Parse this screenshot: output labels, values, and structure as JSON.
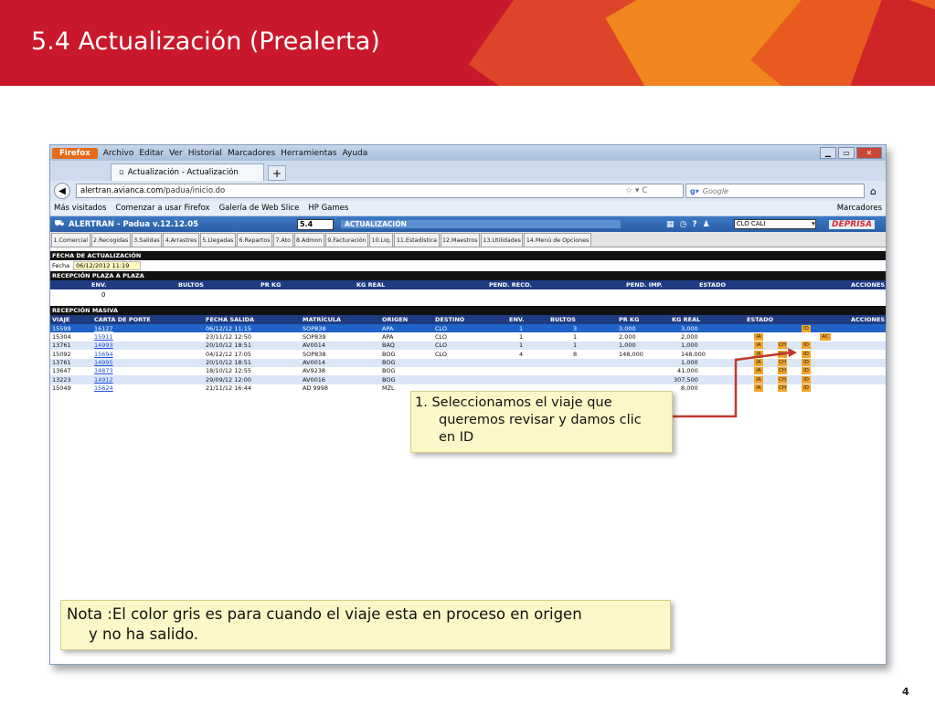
{
  "slide": {
    "title": "5.4 Actualización (Prealerta)",
    "page_number": "4"
  },
  "browser": {
    "firefox_button": "Firefox",
    "menu": [
      "Archivo",
      "Editar",
      "Ver",
      "Historial",
      "Marcadores",
      "Herramientas",
      "Ayuda"
    ],
    "tab_title": "Actualización - Actualización",
    "url_host": "alertran.avianca.com",
    "url_path": "/padua/inicio.do",
    "search_placeholder": "Google",
    "bookmarks": [
      "Más visitados",
      "Comenzar a usar Firefox",
      "Galería de Web Slice",
      "HP Games"
    ],
    "bookmarks_right": "Marcadores"
  },
  "app": {
    "name": "ALERTRAN - Padua  v.12.12.05",
    "module_code": "5.4",
    "module_name": "ACTUALIZACIÓN",
    "branch": "CLO CALI",
    "brand": "DEPRISA",
    "module_tabs": [
      "1.Comercial",
      "2.Recogidas",
      "3.Salidas",
      "4.Arrastres",
      "5.Llegadas",
      "6.Repartos",
      "7.Ato",
      "8.Admon",
      "9.Facturación",
      "10.Liq.",
      "11.Estadística",
      "12.Maestros",
      "13.Utilidades",
      "14.Menú de Opciones"
    ],
    "fecha_section": "FECHA DE ACTUALIZACIÓN",
    "fecha_label": "Fecha",
    "fecha_value": "06/12/2012 11:19",
    "plaza_section": "RECEPCIÓN PLAZA A PLAZA",
    "plaza_headers": [
      "ENV.",
      "BULTOS",
      "PR KG",
      "KG REAL",
      "PEND. RECO.",
      "PEND. IMP.",
      "ESTADO",
      "ACCIONES"
    ],
    "plaza_env_value": "0",
    "masiva_section": "RECEPCIÓN MASIVA",
    "masiva_headers": [
      "VIAJE",
      "CARTA DE PORTE",
      "FECHA SALIDA",
      "MATRÍCULA",
      "ORIGEN",
      "DESTINO",
      "ENV.",
      "BULTOS",
      "PR KG",
      "KG REAL",
      "ESTADO",
      "ACCIONES"
    ],
    "masiva_rows": [
      {
        "viaje": "15599",
        "carta": "16127",
        "fecha": "06/12/12 11:15",
        "matricula": "SOP838",
        "origen": "APA",
        "destino": "CLO",
        "env": "1",
        "bultos": "3",
        "prkg": "3,000",
        "kgreal": "3,000",
        "estado": [
          "",
          "",
          "ID"
        ],
        "accion": ""
      },
      {
        "viaje": "15304",
        "carta": "15911",
        "fecha": "23/11/12 12:50",
        "matricula": "SOP839",
        "origen": "APA",
        "destino": "CLO",
        "env": "1",
        "bultos": "1",
        "prkg": "2,000",
        "kgreal": "2,000",
        "estado": [
          "IA",
          "",
          ""
        ],
        "accion": "AC"
      },
      {
        "viaje": "13761",
        "carta": "14993",
        "fecha": "20/10/12 18:51",
        "matricula": "AV0014",
        "origen": "BAQ",
        "destino": "CLO",
        "env": "1",
        "bultos": "1",
        "prkg": "1,000",
        "kgreal": "1,000",
        "estado": [
          "IA",
          "CH",
          "ID"
        ],
        "accion": ""
      },
      {
        "viaje": "15092",
        "carta": "15694",
        "fecha": "04/12/12 17:05",
        "matricula": "SOP838",
        "origen": "BOG",
        "destino": "CLO",
        "env": "4",
        "bultos": "8",
        "prkg": "148,000",
        "kgreal": "148,000",
        "estado": [
          "IA",
          "CH",
          "ID"
        ],
        "accion": ""
      },
      {
        "viaje": "13761",
        "carta": "14995",
        "fecha": "20/10/12 18:51",
        "matricula": "AV0014",
        "origen": "BOG",
        "destino": "",
        "env": "",
        "bultos": "",
        "prkg": "",
        "kgreal": "1,000",
        "estado": [
          "IA",
          "CH",
          "ID"
        ],
        "accion": ""
      },
      {
        "viaje": "13647",
        "carta": "14873",
        "fecha": "18/10/12 12:55",
        "matricula": "AV9238",
        "origen": "BOG",
        "destino": "",
        "env": "",
        "bultos": "",
        "prkg": "",
        "kgreal": "41,000",
        "estado": [
          "IA",
          "CH",
          "ID"
        ],
        "accion": ""
      },
      {
        "viaje": "13223",
        "carta": "14912",
        "fecha": "29/09/12 12:00",
        "matricula": "AV0016",
        "origen": "BOG",
        "destino": "",
        "env": "",
        "bultos": "",
        "prkg": "",
        "kgreal": "307,500",
        "estado": [
          "IA",
          "CH",
          "ID"
        ],
        "accion": ""
      },
      {
        "viaje": "15049",
        "carta": "15624",
        "fecha": "21/11/12 16:44",
        "matricula": "AD 9998",
        "origen": "MZL",
        "destino": "",
        "env": "",
        "bultos": "",
        "prkg": "",
        "kgreal": "8,000",
        "estado": [
          "IA",
          "CH",
          "ID"
        ],
        "accion": ""
      }
    ]
  },
  "callouts": {
    "step1_line1": "1.  Seleccionamos  el  viaje  que",
    "step1_line2": "queremos revisar y damos clic",
    "step1_line3": "en ID",
    "note_line1": "Nota :El color gris es para  cuando el viaje esta en proceso en origen",
    "note_line2": "y no ha salido."
  },
  "colors": {
    "banner_red": "#c9182b",
    "banner_orange": "#f08a1c",
    "app_blue": "#1f3b82",
    "row_selected": "#1f63c9",
    "row_alt": "#dbe6f7",
    "badge_orange": "#f3a42a",
    "callout_bg": "#fbf7c7",
    "arrow_red": "#c0392b"
  }
}
